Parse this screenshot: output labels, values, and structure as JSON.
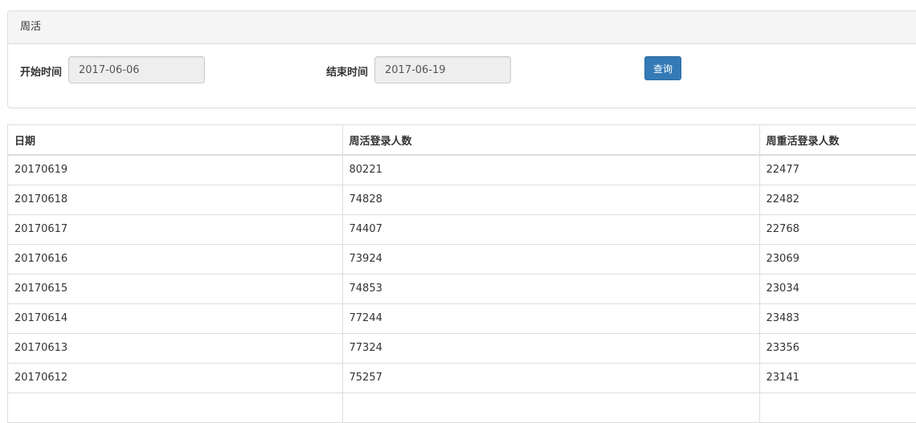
{
  "panel": {
    "title": "周活"
  },
  "form": {
    "start_label": "开始时间",
    "start_value": "2017-06-06",
    "end_label": "结束时间",
    "end_value": "2017-06-19",
    "query_label": "查询"
  },
  "table": {
    "headers": [
      "日期",
      "周活登录人数",
      "周重活登录人数"
    ],
    "rows": [
      [
        "20170619",
        "80221",
        "22477"
      ],
      [
        "20170618",
        "74828",
        "22482"
      ],
      [
        "20170617",
        "74407",
        "22768"
      ],
      [
        "20170616",
        "73924",
        "23069"
      ],
      [
        "20170615",
        "74853",
        "23034"
      ],
      [
        "20170614",
        "77244",
        "23483"
      ],
      [
        "20170613",
        "77324",
        "23356"
      ],
      [
        "20170612",
        "75257",
        "23141"
      ],
      [
        "",
        "",
        ""
      ]
    ]
  },
  "colors": {
    "primary": "#337ab7",
    "border": "#dddddd",
    "heading_bg": "#f5f5f5",
    "input_bg": "#eeeeee"
  }
}
